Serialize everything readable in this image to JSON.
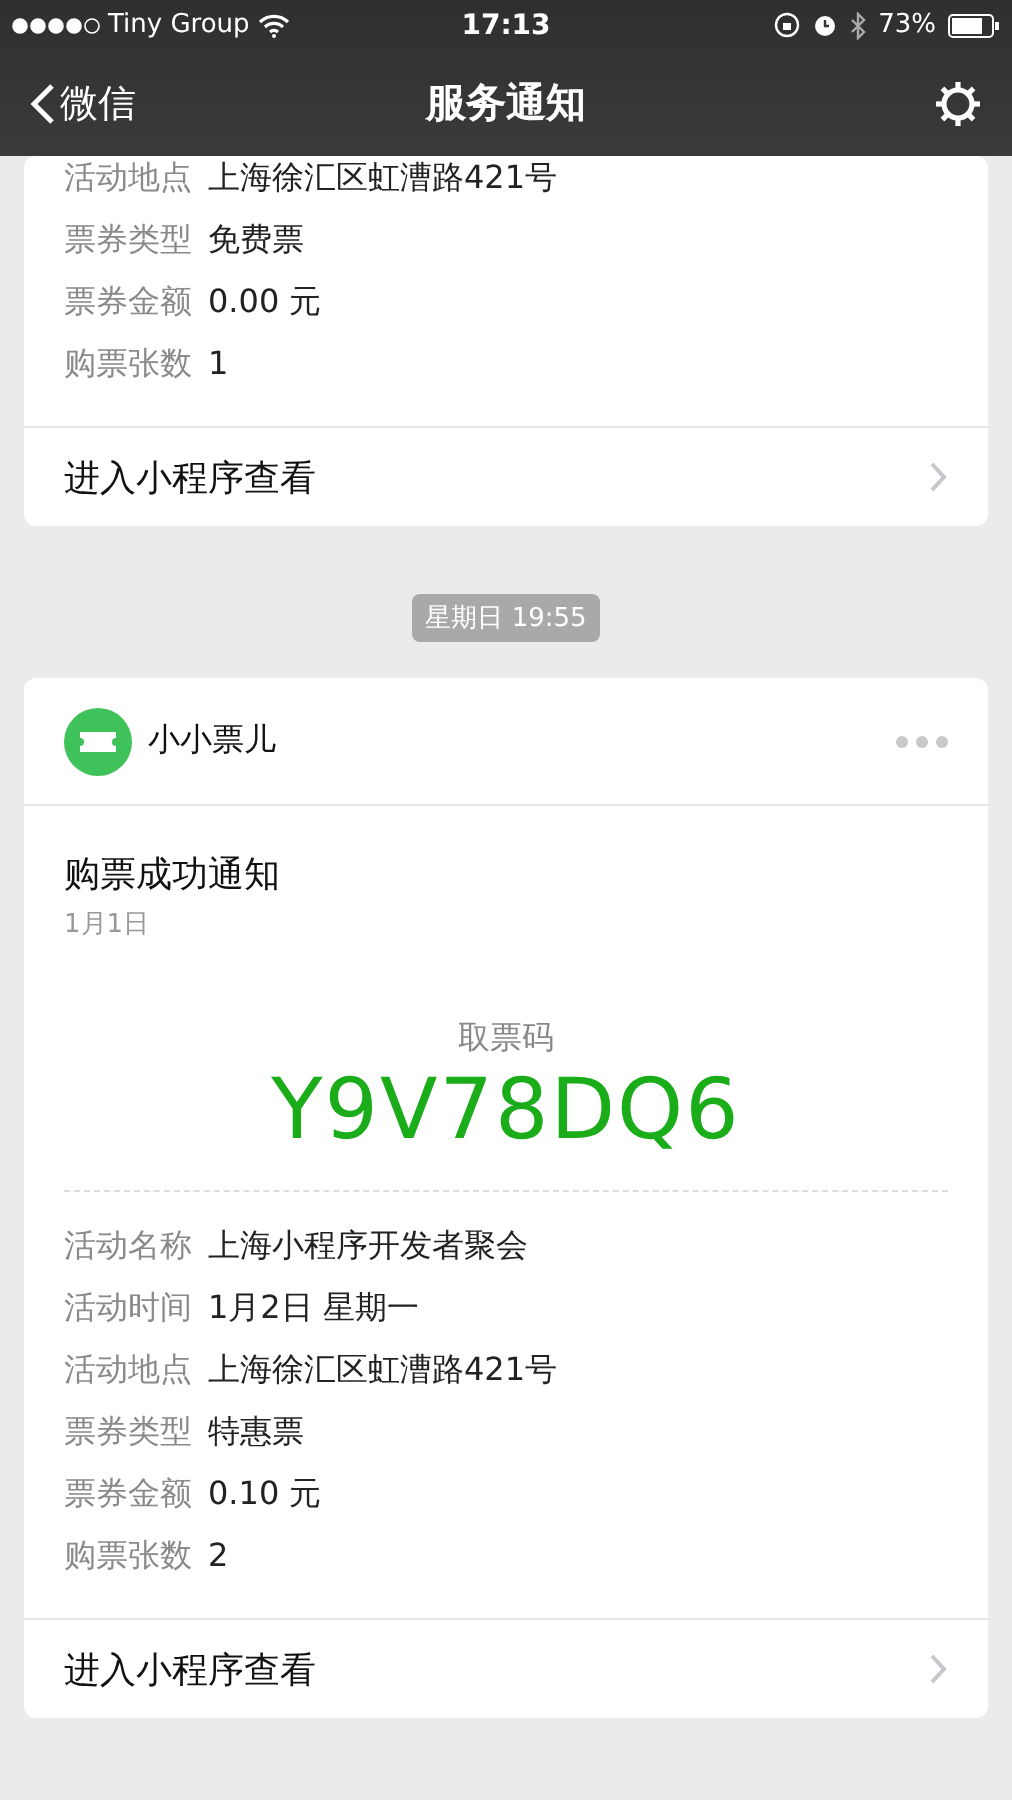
{
  "status_bar": {
    "carrier": "Tiny Group",
    "time": "17:13",
    "battery": "73%"
  },
  "nav": {
    "back": "微信",
    "title": "服务通知"
  },
  "messages": [
    {
      "kind": "partial",
      "fields": [
        {
          "label": "活动地点",
          "value": "上海徐汇区虹漕路421号"
        },
        {
          "label": "票券类型",
          "value": "免费票"
        },
        {
          "label": "票券金额",
          "value": "0.00 元"
        },
        {
          "label": "购票张数",
          "value": "1"
        }
      ],
      "link": "进入小程序查看"
    },
    {
      "kind": "timestamp",
      "text": "星期日 19:55"
    },
    {
      "kind": "full",
      "app": "小小票儿",
      "title": "购票成功通知",
      "date": "1月1日",
      "code_label": "取票码",
      "code": "Y9V78DQ6",
      "fields": [
        {
          "label": "活动名称",
          "value": "上海小程序开发者聚会"
        },
        {
          "label": "活动时间",
          "value": "1月2日 星期一"
        },
        {
          "label": "活动地点",
          "value": "上海徐汇区虹漕路421号"
        },
        {
          "label": "票券类型",
          "value": "特惠票"
        },
        {
          "label": "票券金额",
          "value": "0.10 元"
        },
        {
          "label": "购票张数",
          "value": "2"
        }
      ],
      "link": "进入小程序查看"
    }
  ]
}
